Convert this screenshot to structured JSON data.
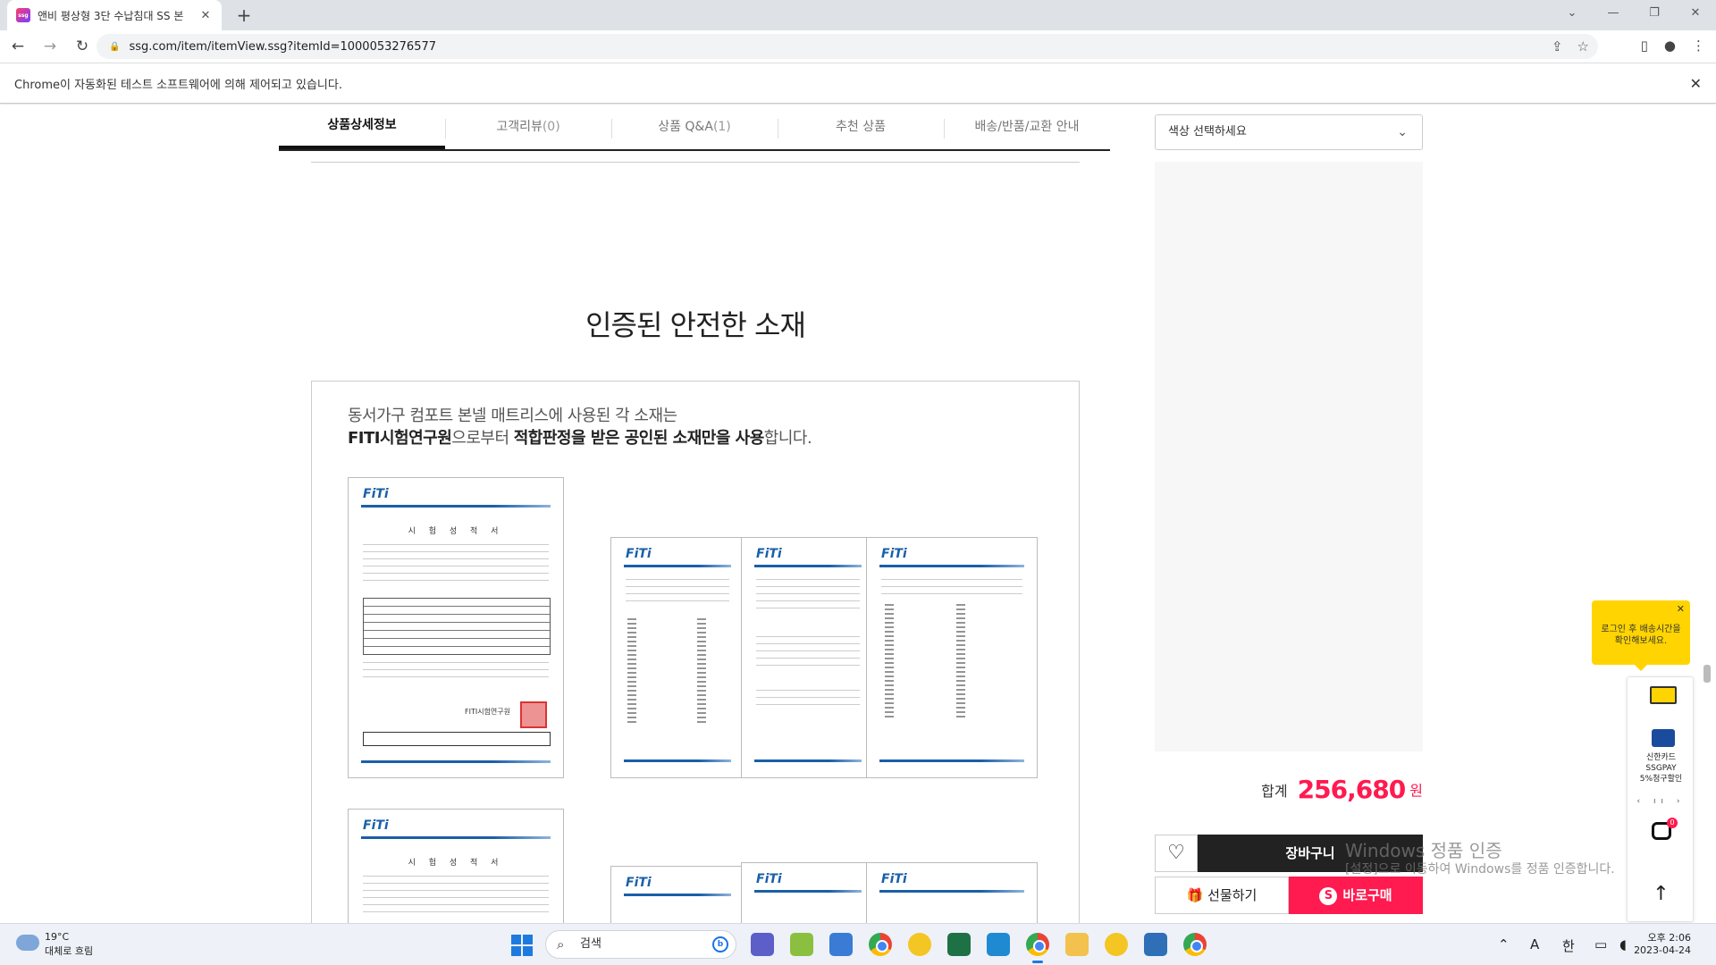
{
  "browser": {
    "tab_title": "앤비 평상형 3단 수납침대 SS 본",
    "tab_favicon_text": "ssg",
    "url": "ssg.com/item/itemView.ssg?itemId=1000053276577",
    "infobar_text": "Chrome이 자동화된 테스트 소프트웨어에 의해 제어되고 있습니다."
  },
  "product_tabs": [
    {
      "label": "상품상세정보",
      "count": ""
    },
    {
      "label": "고객리뷰",
      "count": "(0)"
    },
    {
      "label": "상품 Q&A",
      "count": "(1)"
    },
    {
      "label": "추천 상품",
      "count": ""
    },
    {
      "label": "배송/반품/교환 안내",
      "count": ""
    }
  ],
  "detail": {
    "heading": "인증된 안전한 소재",
    "desc_line1": "동서가구 컴포트 본넬 매트리스에 사용된 각 소재는",
    "desc_line2_bold1": "FITI시험연구원",
    "desc_line2_text1": "으로부터 ",
    "desc_line2_bold2": "적합판정을 받은 공인된 소재만을 사용",
    "desc_line2_text2": "합니다.",
    "cert_logo": "FiTi",
    "cert_doc_title": "시 험 성 적 서",
    "cert_signature": "FITI시험연구원"
  },
  "purchase": {
    "color_select_placeholder": "색상 선택하세요",
    "total_label": "합계",
    "total_amount": "256,680",
    "currency": "원",
    "cart_label": "장바구니",
    "gift_label": "선물하기",
    "buy_now_label": "바로구매",
    "buy_badge": "S"
  },
  "floating": {
    "tooltip_line1": "로그인 후 배송시간을",
    "tooltip_line2": "확인해보세요.",
    "card_line1": "신한카드",
    "card_line2": "SSGPAY",
    "card_line3": "5%청구할인",
    "pager": "‹ ıı ›",
    "notif_count": "0"
  },
  "watermark": {
    "line1": "Windows 정품 인증",
    "line2": "[설정]으로 이동하여 Windows를 정품 인증합니다."
  },
  "taskbar": {
    "temperature": "19°C",
    "weather": "대체로 흐림",
    "search_placeholder": "검색",
    "time": "오후 2:06",
    "date": "2023-04-24",
    "ime_lang": "한",
    "ime_a": "A"
  }
}
